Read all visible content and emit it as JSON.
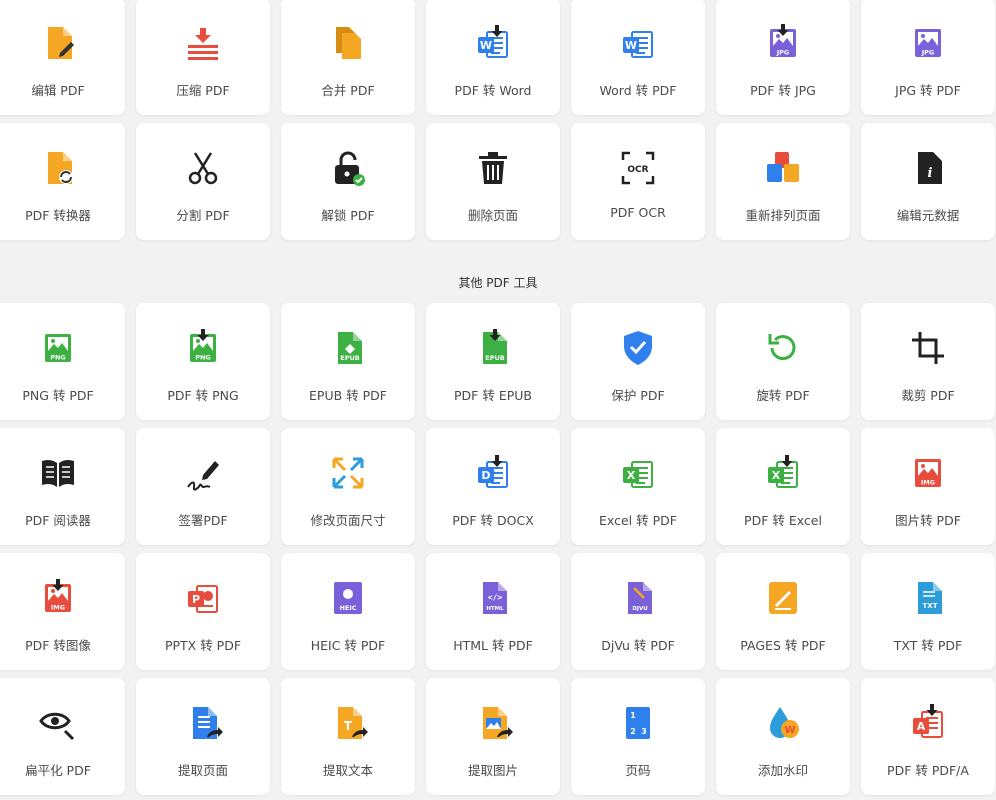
{
  "top_tools": [
    {
      "label": "编辑 PDF",
      "icon": "edit-pdf-icon"
    },
    {
      "label": "压缩 PDF",
      "icon": "compress-pdf-icon"
    },
    {
      "label": "合并 PDF",
      "icon": "merge-pdf-icon"
    },
    {
      "label": "PDF 转 Word",
      "icon": "pdf-to-word-icon"
    },
    {
      "label": "Word 转 PDF",
      "icon": "word-to-pdf-icon"
    },
    {
      "label": "PDF 转 JPG",
      "icon": "pdf-to-jpg-icon"
    },
    {
      "label": "JPG 转 PDF",
      "icon": "jpg-to-pdf-icon"
    },
    {
      "label": "PDF 转换器",
      "icon": "pdf-converter-icon"
    },
    {
      "label": "分割 PDF",
      "icon": "scissors-icon"
    },
    {
      "label": "解锁 PDF",
      "icon": "unlock-icon"
    },
    {
      "label": "删除页面",
      "icon": "trash-icon"
    },
    {
      "label": "PDF OCR",
      "icon": "ocr-icon"
    },
    {
      "label": "重新排列页面",
      "icon": "rearrange-pages-icon"
    },
    {
      "label": "编辑元数据",
      "icon": "metadata-icon"
    }
  ],
  "section_title": "其他 PDF 工具",
  "other_tools": [
    {
      "label": "PNG 转 PDF",
      "icon": "png-to-pdf-icon"
    },
    {
      "label": "PDF 转 PNG",
      "icon": "pdf-to-png-icon"
    },
    {
      "label": "EPUB 转 PDF",
      "icon": "epub-to-pdf-icon"
    },
    {
      "label": "PDF 转 EPUB",
      "icon": "pdf-to-epub-icon"
    },
    {
      "label": "保护 PDF",
      "icon": "shield-icon"
    },
    {
      "label": "旋转 PDF",
      "icon": "rotate-icon"
    },
    {
      "label": "裁剪 PDF",
      "icon": "crop-icon"
    },
    {
      "label": "PDF 阅读器",
      "icon": "book-icon"
    },
    {
      "label": "签署PDF",
      "icon": "signature-icon"
    },
    {
      "label": "修改页面尺寸",
      "icon": "resize-icon"
    },
    {
      "label": "PDF 转 DOCX",
      "icon": "pdf-to-docx-icon"
    },
    {
      "label": "Excel 转 PDF",
      "icon": "excel-to-pdf-icon"
    },
    {
      "label": "PDF 转 Excel",
      "icon": "pdf-to-excel-icon"
    },
    {
      "label": "图片转 PDF",
      "icon": "image-to-pdf-icon"
    },
    {
      "label": "PDF 转图像",
      "icon": "pdf-to-image-icon"
    },
    {
      "label": "PPTX 转 PDF",
      "icon": "pptx-to-pdf-icon"
    },
    {
      "label": "HEIC 转 PDF",
      "icon": "heic-to-pdf-icon"
    },
    {
      "label": "HTML 转 PDF",
      "icon": "html-to-pdf-icon"
    },
    {
      "label": "DjVu 转 PDF",
      "icon": "djvu-to-pdf-icon"
    },
    {
      "label": "PAGES 转 PDF",
      "icon": "pages-to-pdf-icon"
    },
    {
      "label": "TXT 转 PDF",
      "icon": "txt-to-pdf-icon"
    },
    {
      "label": "扁平化 PDF",
      "icon": "flatten-eye-icon"
    },
    {
      "label": "提取页面",
      "icon": "extract-pages-icon"
    },
    {
      "label": "提取文本",
      "icon": "extract-text-icon"
    },
    {
      "label": "提取图片",
      "icon": "extract-images-icon"
    },
    {
      "label": "页码",
      "icon": "page-numbers-icon"
    },
    {
      "label": "添加水印",
      "icon": "watermark-icon"
    },
    {
      "label": "PDF 转 PDF/A",
      "icon": "pdf-to-pdfa-icon"
    }
  ],
  "badges": {
    "word": "W",
    "jpg": "JPG",
    "png": "PNG",
    "epub": "EPUB",
    "docx": "D",
    "excel": "X",
    "img": "IMG",
    "pptx": "P",
    "heic": "HEIC",
    "html": "</>",
    "djvu": "DJVU",
    "txt": "TXT",
    "text": "T",
    "ocr": "OCR",
    "pdfa": "A",
    "info": "i"
  },
  "colors": {
    "orange": "#f5a623",
    "red": "#e74c3c",
    "blue": "#2f80ed",
    "purple": "#7b61d9",
    "green": "#3cb043",
    "dark": "#333333",
    "teal": "#2d9cdb",
    "excel_green": "#3cb043"
  }
}
